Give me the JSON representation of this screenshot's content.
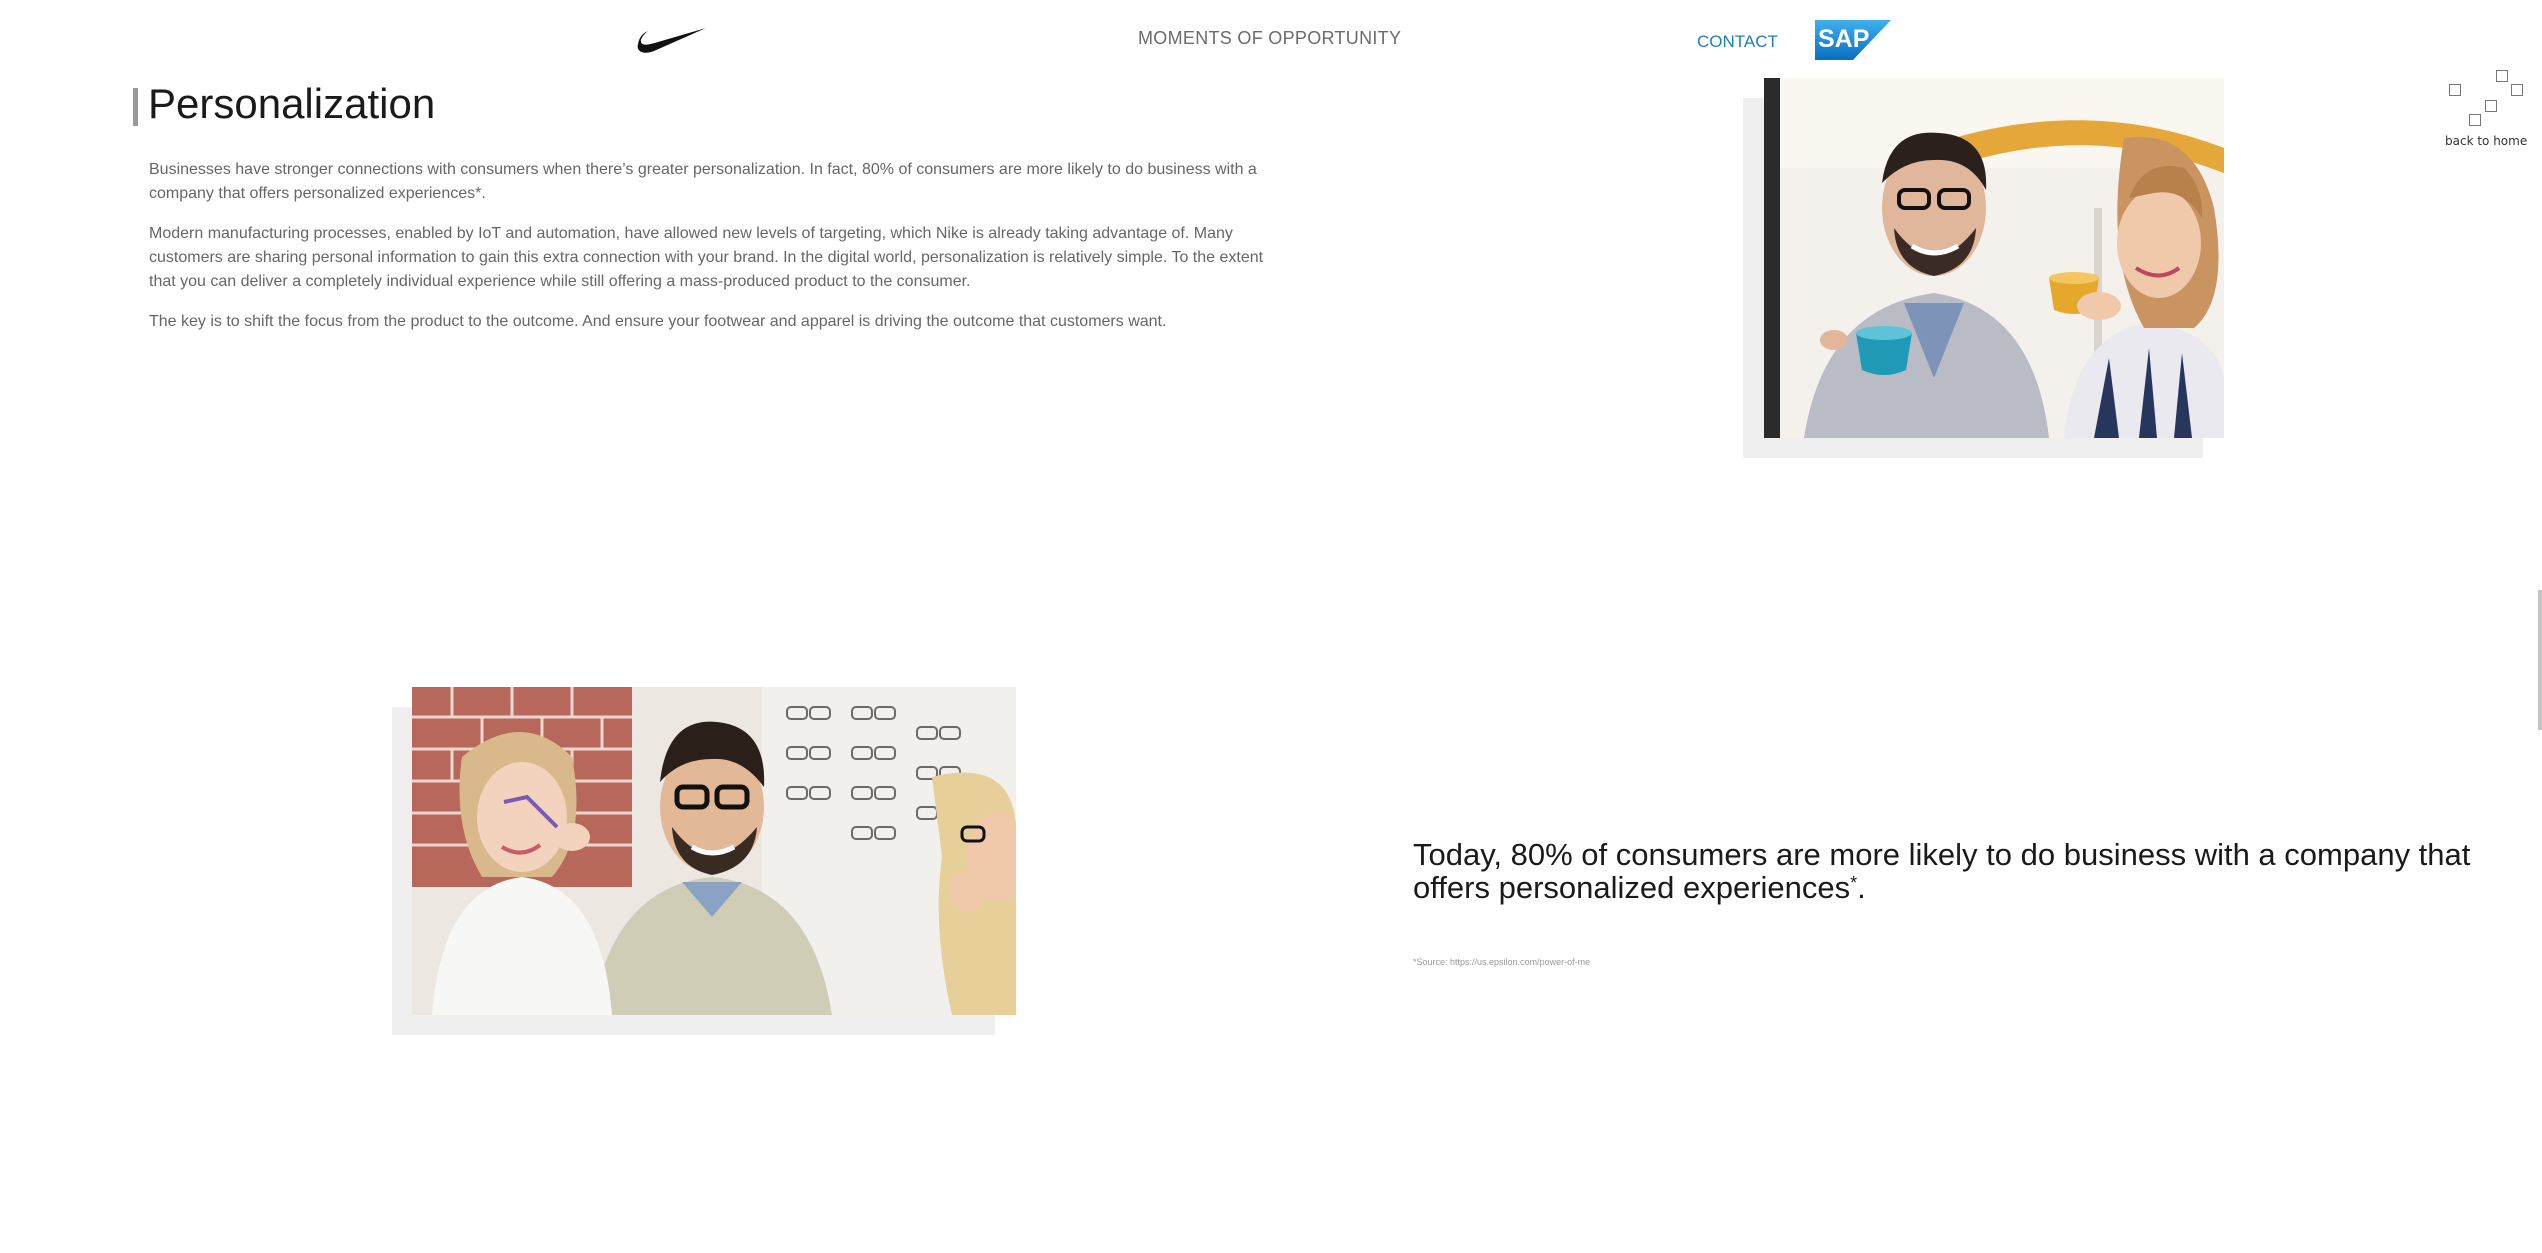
{
  "header": {
    "title": "MOMENTS OF OPPORTUNITY",
    "contact_label": "CONTACT",
    "nike_logo_icon": "nike-swoosh-icon",
    "sap_logo_icon": "sap-logo-icon",
    "sap_logo_text": "SAP"
  },
  "back_to_home": {
    "label": "back to home",
    "icon": "squares-grid-icon"
  },
  "section": {
    "title": "Personalization",
    "paragraphs": [
      "Businesses have stronger connections with consumers when there’s greater personalization. In fact, 80% of consumers are more likely to do business with a company that offers personalized experiences*.",
      "Modern manufacturing processes, enabled by IoT and automation, have allowed new levels of targeting, which Nike is already taking advantage of. Many customers are sharing personal information to gain this extra connection with your brand. In the digital world, personalization is relatively simple. To the extent that you can deliver a completely individual experience while still offering a mass-produced product to the consumer.",
      "The key is to shift the focus from the product to the outcome. And ensure your footwear and apparel is driving the outcome that customers want."
    ]
  },
  "quote": {
    "text": "Today, 80% of consumers are more likely to do business with a company that offers personalized experiences",
    "marker": "*",
    "end": ".",
    "source": "*Source: https://us.epsilon.com/power-of-me"
  },
  "images": {
    "top_photo": "coffee-couple-photo",
    "bottom_photo": "family-eyeglasses-photo"
  },
  "colors": {
    "accent": "#1a7fc1",
    "sap_blue": "#1b8fd6",
    "section_bar": "#9a9a9a",
    "photo_shadow": "#efefef"
  }
}
